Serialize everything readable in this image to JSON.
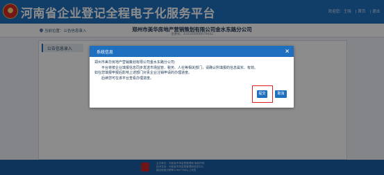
{
  "header": {
    "site_title": "河南省企业登记全程电子化服务平台",
    "links": [
      "欢迎您：王晓",
      "| 首页",
      "| 退出"
    ]
  },
  "crumbbar": {
    "breadcrumb": "当前位置：公告信息录入",
    "company_name": "郑州市美华房地产营销策划有限公司金水东路分公司",
    "company_code": "注册号：410105000079442"
  },
  "content": {
    "section_title": "公告信息录入"
  },
  "dialog": {
    "title": "系统信息",
    "close_label": "×",
    "lines": [
      "郑州市美华房地产营销策划有限公司金水东路分公司:",
      "平台将按企业填报信息同步发送市场监管、税务、人社等相关部门，请确认所填报的信息属实、有效。",
      "如在您填报申报后影响上述部门对贵企业注销申请的办理进度。",
      "后续您可在该平台查看办理进度。"
    ],
    "submit_label": "提交",
    "cancel_label": "取消"
  },
  "footer": {
    "lines": [
      "主办单位：河南省市场监督管理局  版权所有",
      "技术支持：河南省市场监督管理局信息中心",
      "建议使用分辨率1280*768以上浏览"
    ]
  },
  "colors": {
    "brand_blue": "#1f6fbf",
    "highlight_red": "#e02020"
  }
}
